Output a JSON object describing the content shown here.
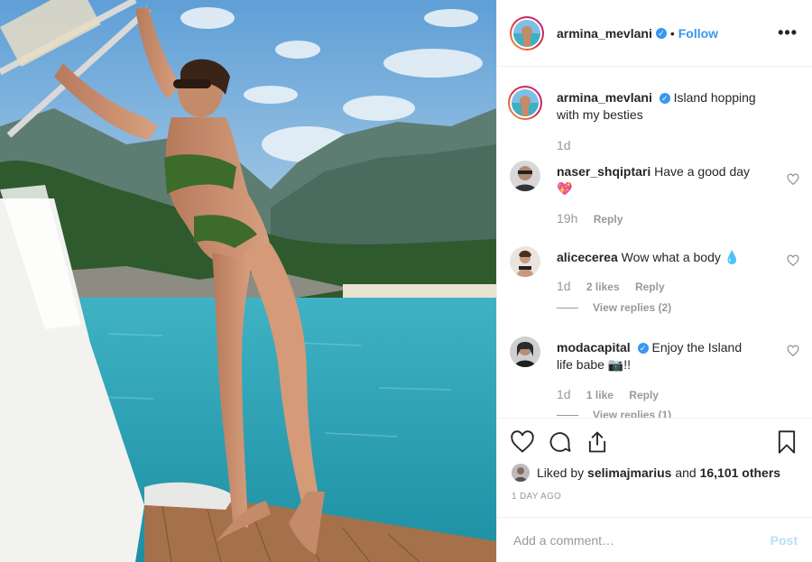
{
  "post": {
    "author": "armina_mevlani",
    "follow_label": "Follow",
    "dot": "•",
    "more_label": "•••",
    "caption": "Island hopping with my besties",
    "caption_time": "1d"
  },
  "comments": [
    {
      "user": "naser_shqiptari",
      "text": "Have a good day 💖",
      "time": "19h",
      "likes": "",
      "reply": "Reply"
    },
    {
      "user": "alicecerea",
      "text": "Wow what a body 💧",
      "time": "1d",
      "likes": "2 likes",
      "reply": "Reply",
      "view_replies": "View replies (2)"
    },
    {
      "user": "modacapital",
      "verified": true,
      "text": "Enjoy the Island life babe 📷!!",
      "time": "1d",
      "likes": "1 like",
      "reply": "Reply",
      "view_replies": "View replies (1)"
    }
  ],
  "footer": {
    "liked_by_prefix": "Liked by",
    "liked_by_user": "selimajmarius",
    "liked_by_and": "and",
    "liked_by_count": "16,101 others",
    "time_ago": "1 DAY AGO",
    "comment_placeholder": "Add a comment…",
    "post_label": "Post"
  },
  "colors": {
    "accent": "#3897f0",
    "post_disabled": "#b2dffc",
    "muted": "#999999"
  },
  "icons": [
    "verified-badge-icon",
    "heart-icon",
    "comment-icon",
    "share-icon",
    "bookmark-icon",
    "more-icon"
  ]
}
